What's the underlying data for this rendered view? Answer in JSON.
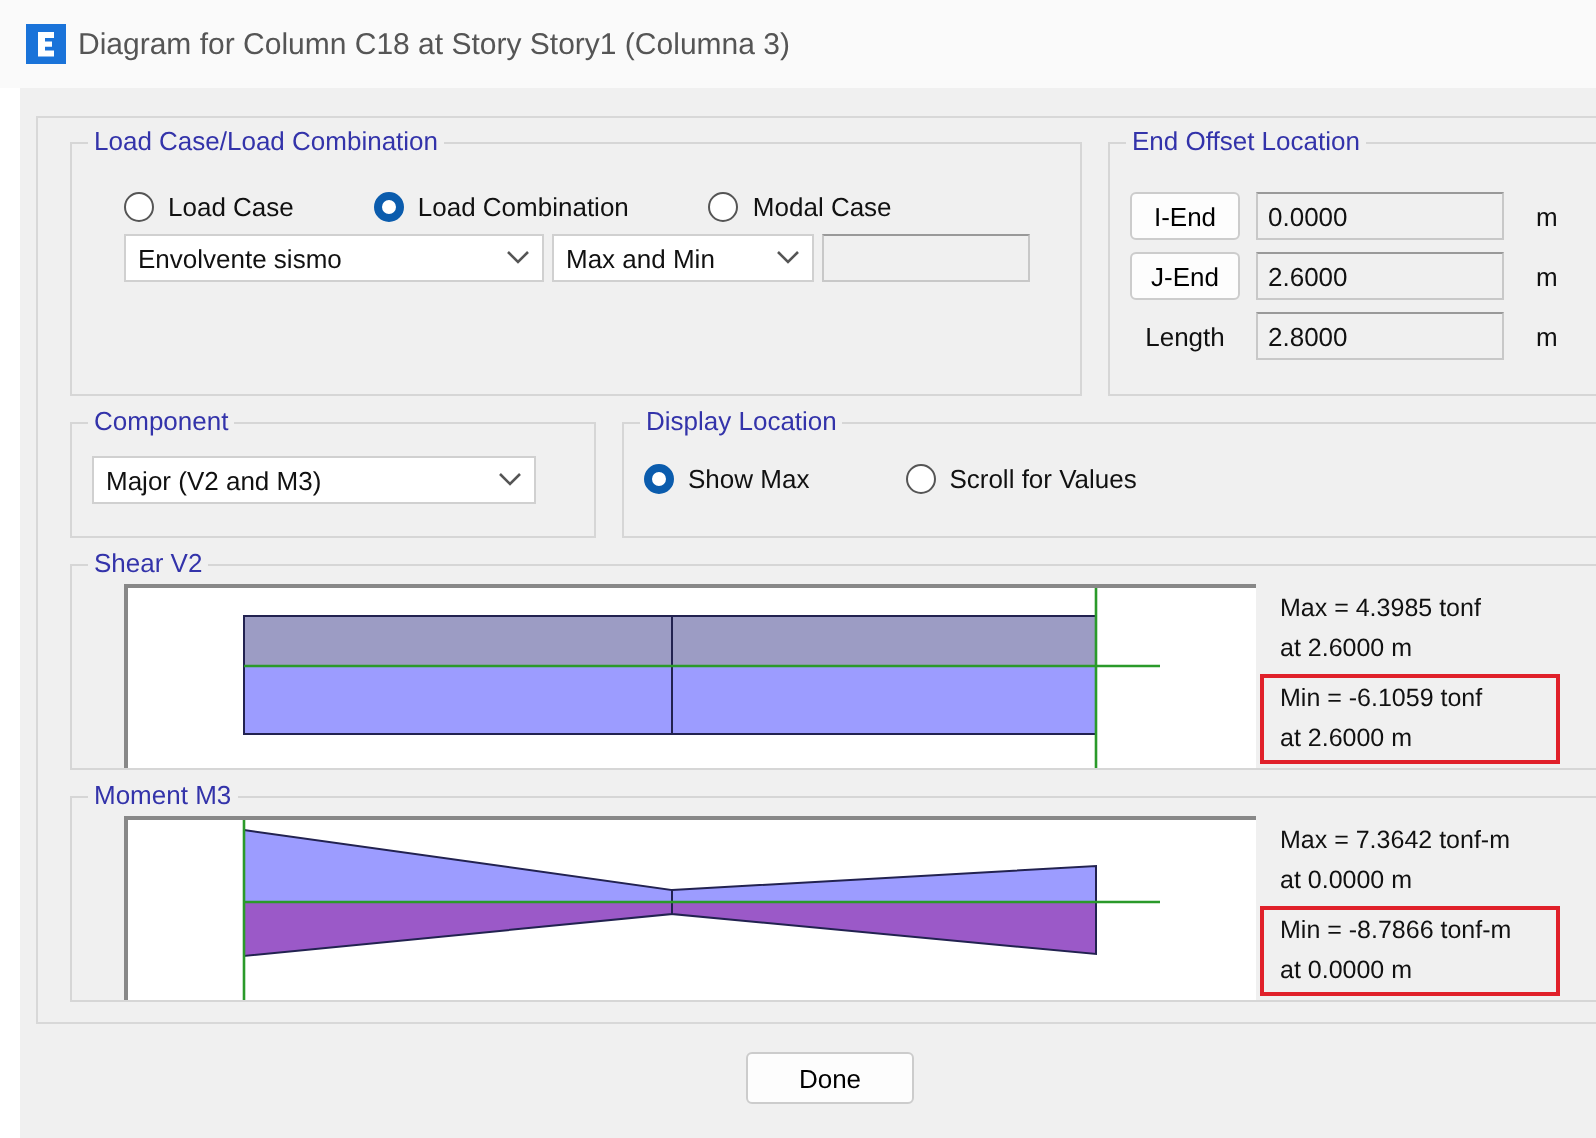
{
  "window": {
    "title": "Diagram for Column C18 at Story Story1 (Columna 3)"
  },
  "load_case": {
    "title": "Load Case/Load Combination",
    "options": [
      {
        "label": "Load Case",
        "selected": false
      },
      {
        "label": "Load Combination",
        "selected": true
      },
      {
        "label": "Modal Case",
        "selected": false
      }
    ],
    "combo": "Envolvente sismo",
    "mode": "Max and Min"
  },
  "end_offset": {
    "title": "End Offset Location",
    "rows": [
      {
        "kind": "button",
        "label": "I-End",
        "value": "0.0000",
        "unit": "m"
      },
      {
        "kind": "button",
        "label": "J-End",
        "value": "2.6000",
        "unit": "m"
      },
      {
        "kind": "text",
        "label": "Length",
        "value": "2.8000",
        "unit": "m"
      }
    ]
  },
  "component": {
    "title": "Component",
    "value": "Major (V2 and M3)"
  },
  "display_location": {
    "title": "Display Location",
    "options": [
      {
        "label": "Show Max",
        "selected": true
      },
      {
        "label": "Scroll for Values",
        "selected": false
      }
    ]
  },
  "diagrams": [
    {
      "kind": "shear",
      "title": "Shear V2",
      "readings": [
        {
          "lines": [
            "Max = 4.3985 tonf",
            "at 2.6000 m"
          ],
          "highlighted": false
        },
        {
          "lines": [
            "Min = -6.1059 tonf",
            "at 2.6000 m"
          ],
          "highlighted": true
        }
      ]
    },
    {
      "kind": "moment",
      "title": "Moment M3",
      "readings": [
        {
          "lines": [
            "Max = 7.3642 tonf-m",
            "at 0.0000 m"
          ],
          "highlighted": false
        },
        {
          "lines": [
            "Min = -8.7866 tonf-m",
            "at 0.0000 m"
          ],
          "highlighted": true
        }
      ]
    }
  ],
  "buttons": [
    "Done"
  ]
}
